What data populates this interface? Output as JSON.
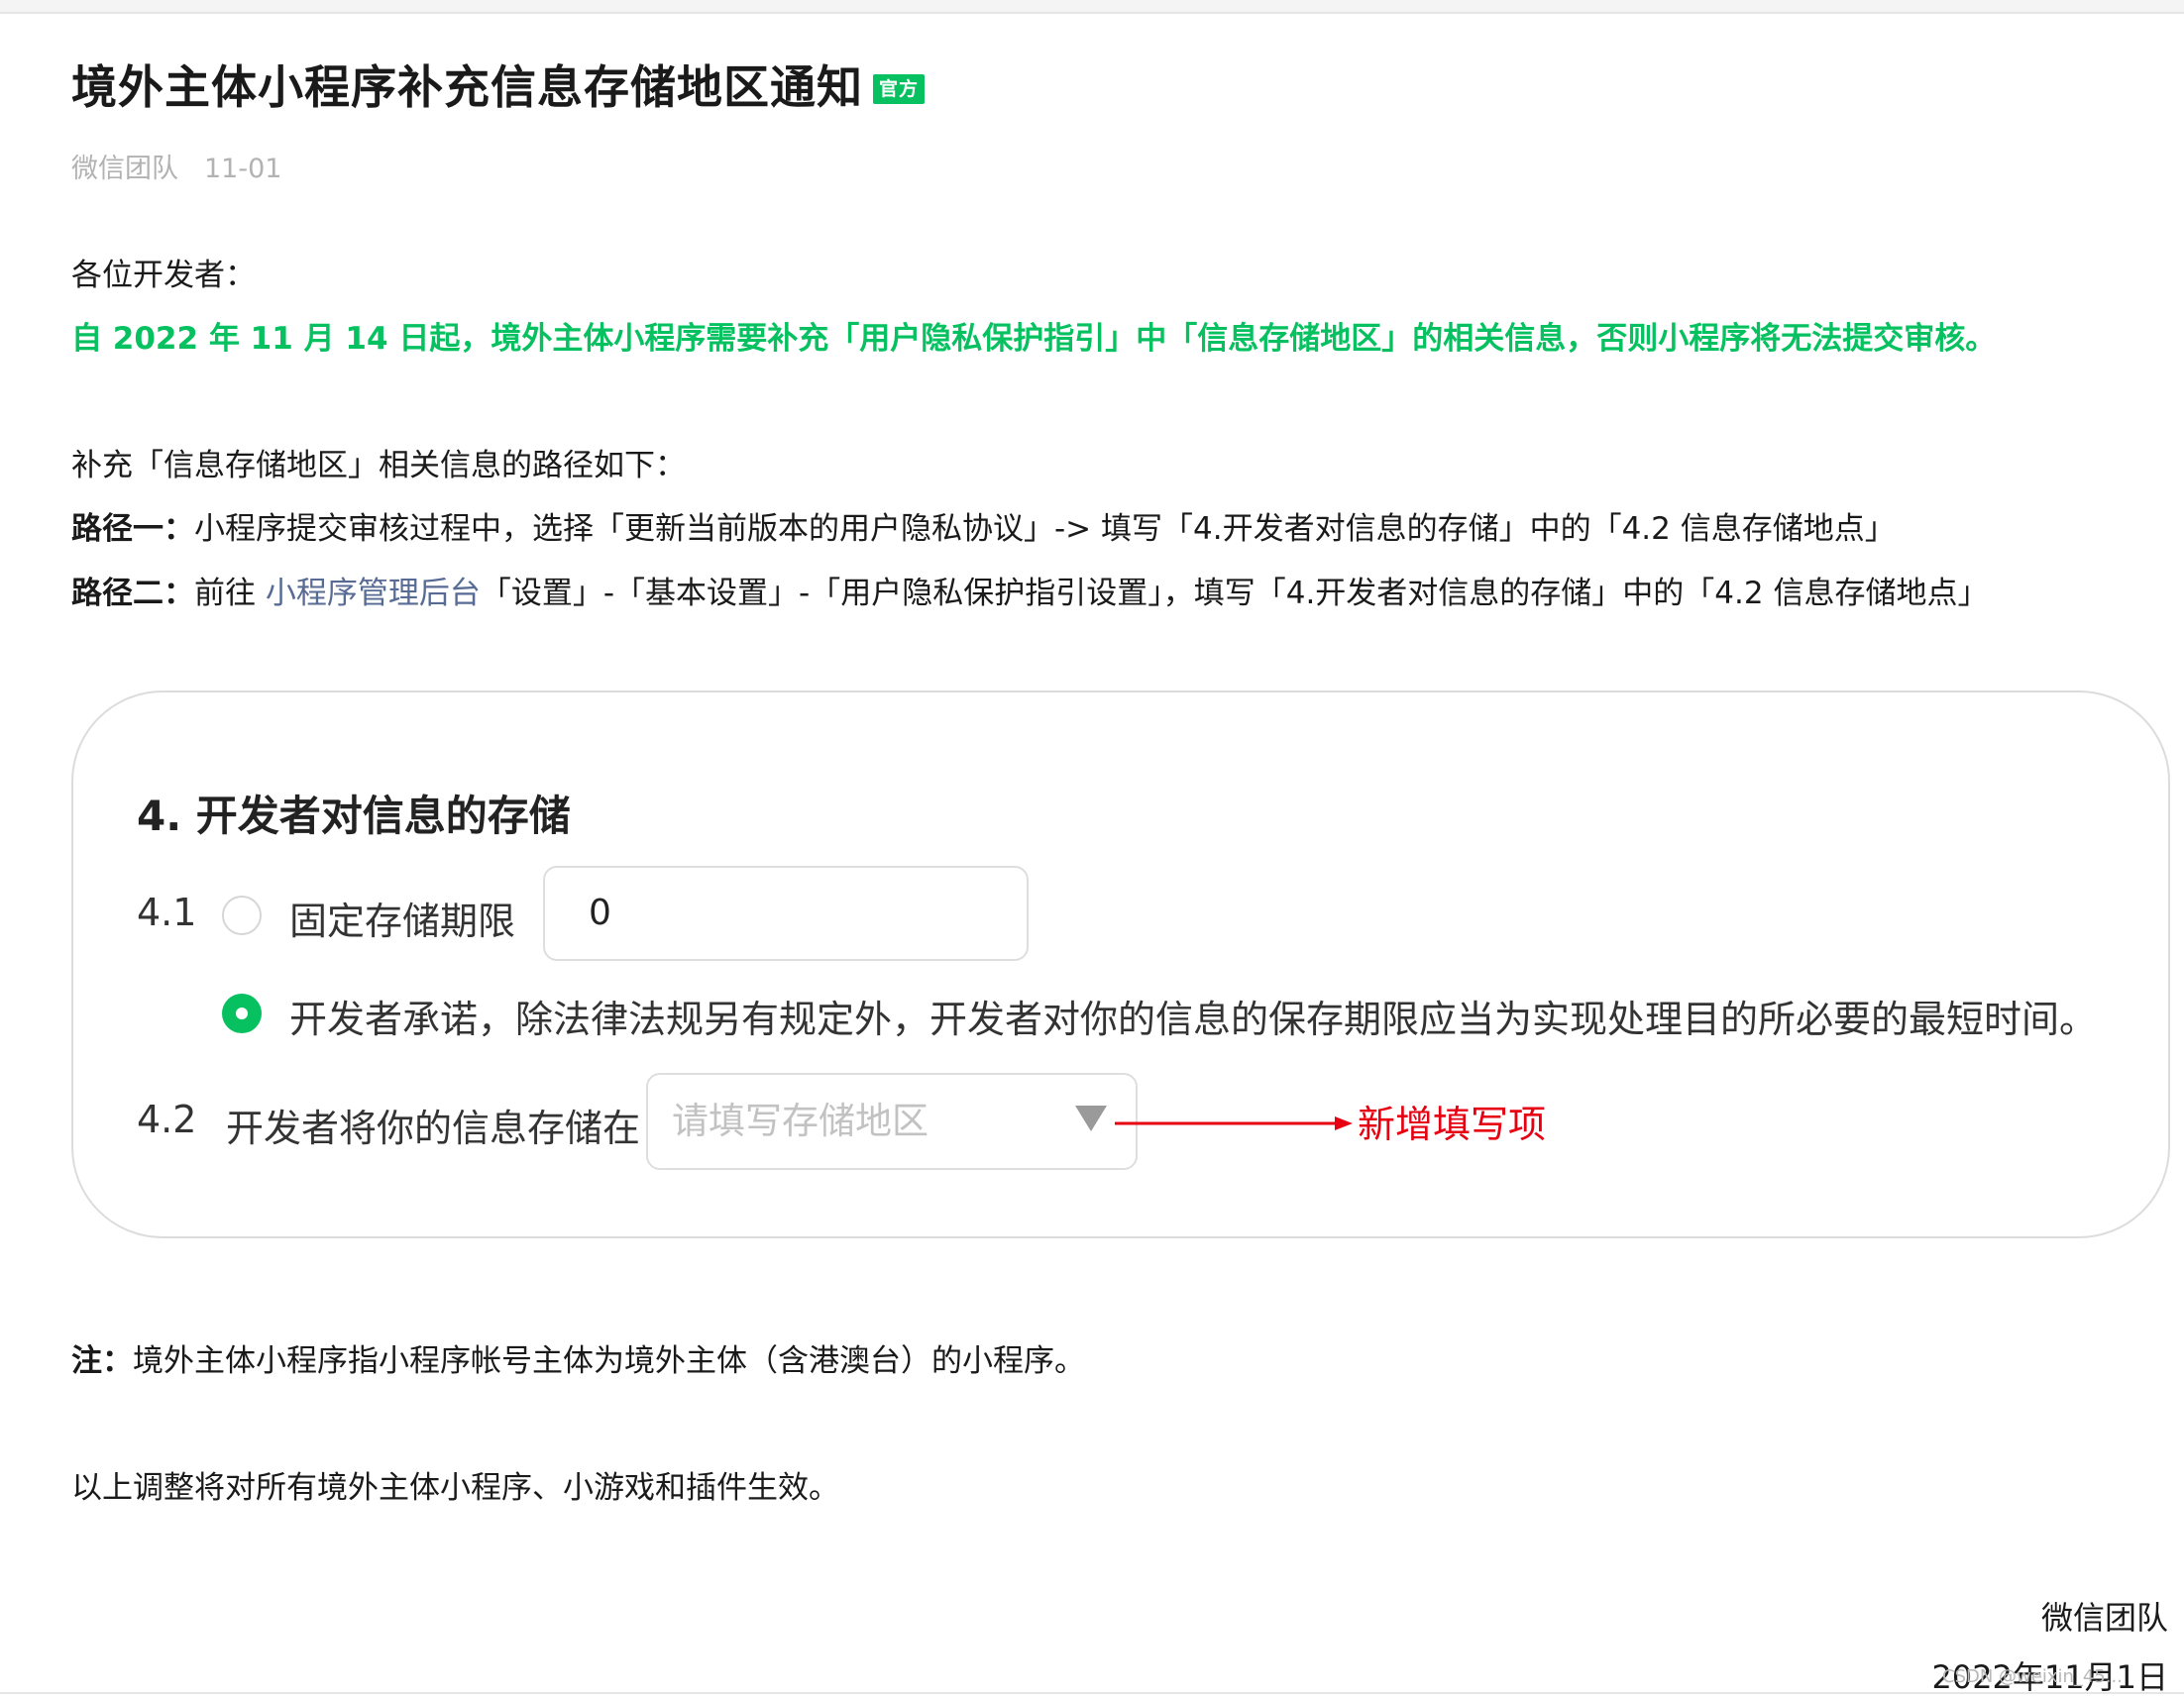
{
  "article": {
    "title": "境外主体小程序补充信息存储地区通知",
    "badge": "官方",
    "author": "微信团队",
    "date": "11-01",
    "greeting": "各位开发者：",
    "highlight": "自 2022 年 11 月 14 日起，境外主体小程序需要补充「用户隐私保护指引」中「信息存储地区」的相关信息，否则小程序将无法提交审核。",
    "path_intro": "补充「信息存储地区」相关信息的路径如下：",
    "path1_label": "路径一：",
    "path1_text": "小程序提交审核过程中，选择「更新当前版本的用户隐私协议」-> 填写「4.开发者对信息的存储」中的「4.2 信息存储地点」",
    "path2_label": "路径二：",
    "path2_prefix": "前往 ",
    "path2_link": "小程序管理后台",
    "path2_suffix": "「设置」-「基本设置」-「用户隐私保护指引设置」，填写「4.开发者对信息的存储」中的「4.2 信息存储地点」",
    "note_label": "注：",
    "note_text": "境外主体小程序指小程序帐号主体为境外主体（含港澳台）的小程序。",
    "effect_text": "以上调整将对所有境外主体小程序、小游戏和插件生效。",
    "sign_team": "微信团队",
    "sign_date": "2022年11月1日",
    "watermark": "CSDN @weixin_45..."
  },
  "form": {
    "section_title": "4.  开发者对信息的存储",
    "item41_number": "4.1",
    "option_fixed_label": "固定存储期限",
    "fixed_period_value": "0",
    "option_promise_label": "开发者承诺，除法律法规另有规定外，开发者对你的信息的保存期限应当为实现处理目的所必要的最短时间。",
    "item42_number": "4.2",
    "item42_label": "开发者将你的信息存储在",
    "region_placeholder": "请填写存储地区",
    "new_item_note": "新增填写项"
  },
  "colors": {
    "brand_green": "#07c160",
    "link_blue": "#576b95",
    "annotation_red": "#e60012"
  }
}
